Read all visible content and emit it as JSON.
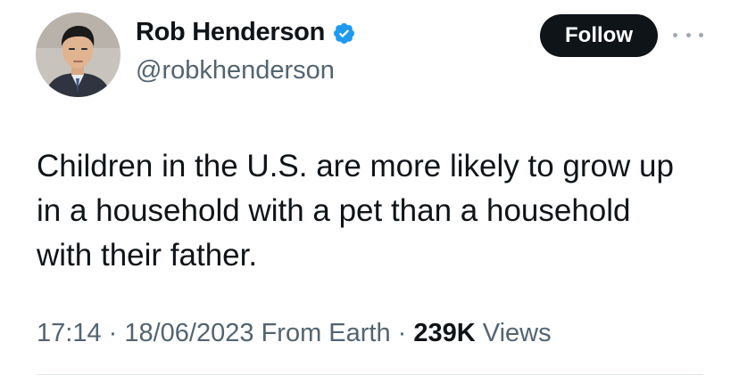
{
  "author": {
    "display_name": "Rob Henderson",
    "handle": "@robkhenderson",
    "verified": true,
    "verified_color": "#1d9bf0"
  },
  "follow_button": {
    "label": "Follow",
    "background": "#0f1419",
    "text_color": "#ffffff"
  },
  "more_menu": {
    "icon": "more-dots-icon"
  },
  "tweet": {
    "text_lines": [
      "Children in the U.S. are more likely to grow up",
      "in a household with a pet than a household",
      "with their father."
    ]
  },
  "meta": {
    "time": "17:14",
    "separator": " · ",
    "date": "18/06/2023",
    "source": "From Earth",
    "views_count": "239K",
    "views_label": "Views"
  },
  "colors": {
    "text": "#0f1419",
    "secondary": "#536471",
    "divider": "#e4e7ea"
  }
}
